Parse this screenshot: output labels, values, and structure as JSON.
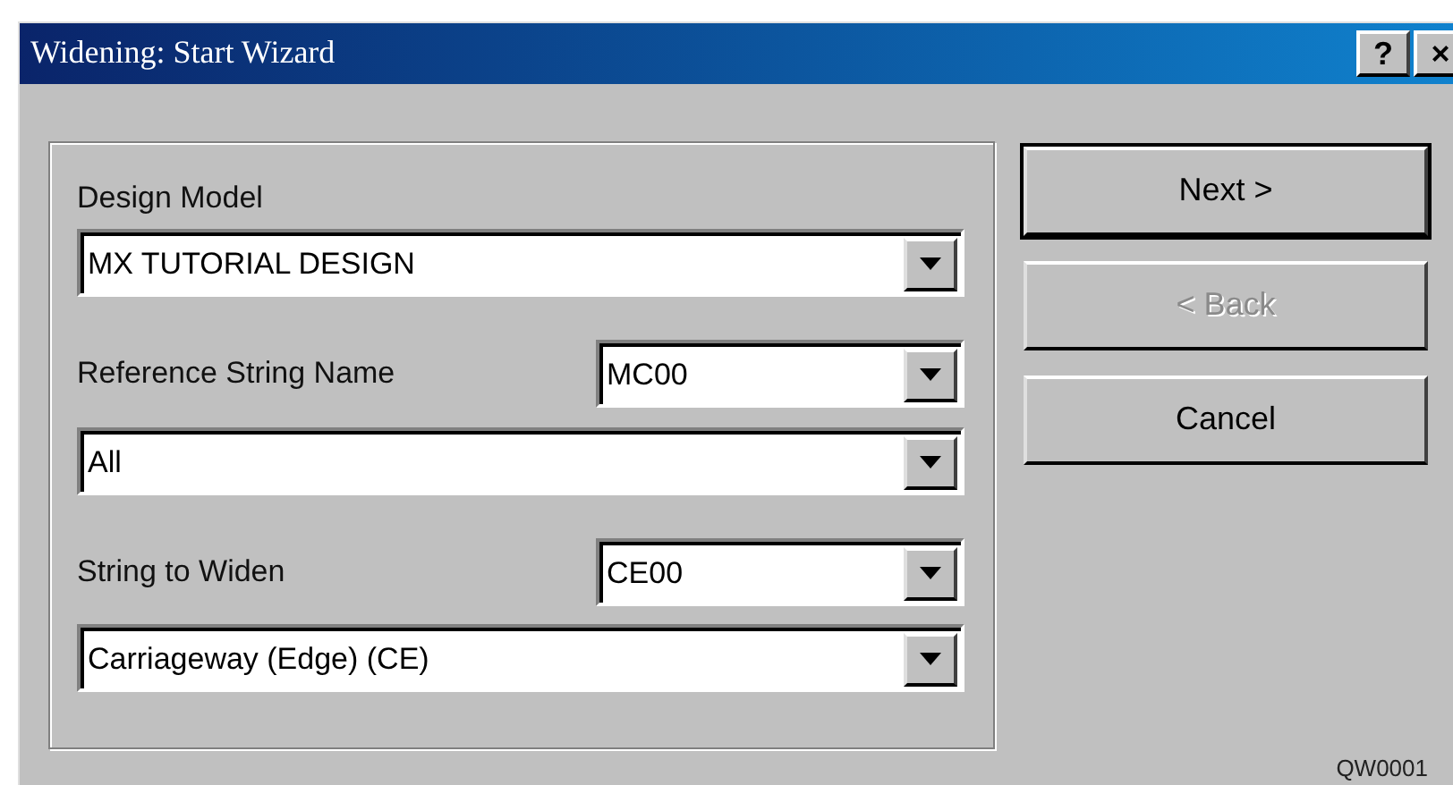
{
  "window": {
    "title": "Widening: Start Wizard",
    "title_buttons": [
      "?",
      "×"
    ]
  },
  "form": {
    "design_model": {
      "label": "Design Model",
      "value": "MX TUTORIAL DESIGN"
    },
    "reference_string": {
      "label": "Reference String Name",
      "value": "MC00",
      "filter": "All"
    },
    "string_to_widen": {
      "label": "String to Widen",
      "value": "CE00",
      "filter": "Carriageway (Edge) (CE)"
    }
  },
  "buttons": [
    {
      "label": "Next >",
      "default": true,
      "disabled": false
    },
    {
      "label": "< Back",
      "default": false,
      "disabled": true
    },
    {
      "label": "Cancel",
      "default": false,
      "disabled": false
    }
  ],
  "form_code": "QW0001"
}
